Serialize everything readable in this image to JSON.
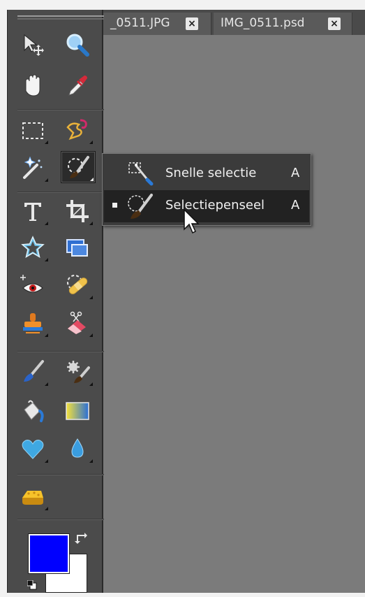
{
  "tabs": [
    {
      "label": "_0511.JPG",
      "close": "×"
    },
    {
      "label": "IMG_0511.psd",
      "close": "×"
    }
  ],
  "toolbox": {
    "tools": [
      {
        "name": "move-tool"
      },
      {
        "name": "zoom-tool"
      },
      {
        "name": "hand-tool"
      },
      {
        "name": "eyedropper-tool"
      },
      {
        "name": "rectangular-marquee-tool"
      },
      {
        "name": "lasso-tool"
      },
      {
        "name": "magic-wand-tool"
      },
      {
        "name": "selection-brush-tool"
      },
      {
        "name": "type-tool"
      },
      {
        "name": "crop-tool"
      },
      {
        "name": "custom-shape-tool"
      },
      {
        "name": "recompose-tool"
      },
      {
        "name": "red-eye-tool"
      },
      {
        "name": "healing-brush-tool"
      },
      {
        "name": "clone-stamp-tool"
      },
      {
        "name": "eraser-tool"
      },
      {
        "name": "brush-tool"
      },
      {
        "name": "smart-brush-tool"
      },
      {
        "name": "paint-bucket-tool"
      },
      {
        "name": "gradient-tool"
      },
      {
        "name": "cookie-cutter-tool"
      },
      {
        "name": "blur-tool"
      },
      {
        "name": "sponge-tool"
      }
    ],
    "foreground_color": "#0000ff",
    "background_color": "#ffffff"
  },
  "flyout": {
    "items": [
      {
        "label": "Snelle selectie",
        "shortcut": "A",
        "selected": false
      },
      {
        "label": "Selectiepenseel",
        "shortcut": "A",
        "selected": true
      }
    ]
  },
  "colors": {
    "canvas": "#7b7b7b",
    "toolbox": "#4b4b4b",
    "menu": "#3b3b3b"
  }
}
